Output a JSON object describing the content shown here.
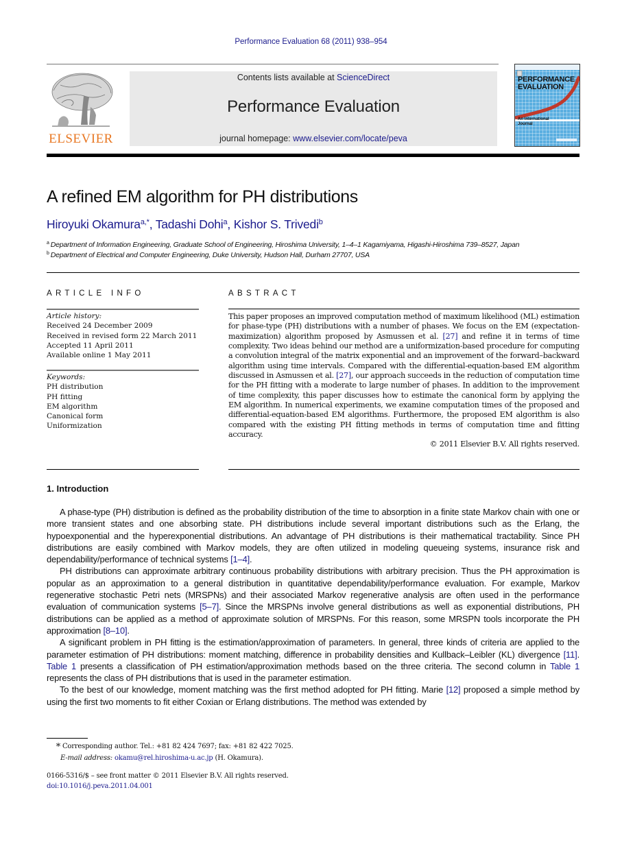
{
  "running_head": "Performance Evaluation 68 (2011) 938–954",
  "masthead": {
    "contents_prefix": "Contents lists available at ",
    "contents_link": "ScienceDirect",
    "journal_title": "Performance Evaluation",
    "homepage_prefix": "journal homepage: ",
    "homepage_link": "www.elsevier.com/locate/peva",
    "publisher_logo_text": "ELSEVIER",
    "cover_title_line1": "PERFORMANCE",
    "cover_title_line2": "EVALUATION",
    "cover_subtitle_line1": "An International",
    "cover_subtitle_line2": "Journal"
  },
  "article": {
    "title": "A refined EM algorithm for PH distributions",
    "authors": [
      {
        "name": "Hiroyuki Okamura",
        "marks": "a,*",
        "sep": ", "
      },
      {
        "name": "Tadashi Dohi",
        "marks": "a",
        "sep": ", "
      },
      {
        "name": "Kishor S. Trivedi",
        "marks": "b",
        "sep": ""
      }
    ],
    "affiliations": [
      {
        "mark": "a",
        "text": "Department of Information Engineering, Graduate School of Engineering, Hiroshima University, 1–4–1 Kagamiyama, Higashi-Hiroshima 739–8527, Japan"
      },
      {
        "mark": "b",
        "text": "Department of Electrical and Computer Engineering, Duke University, Hudson Hall, Durham 27707, USA"
      }
    ]
  },
  "article_info": {
    "label": "ARTICLE INFO",
    "history_heading": "Article history:",
    "history": [
      "Received 24 December 2009",
      "Received in revised form 22 March 2011",
      "Accepted 11 April 2011",
      "Available online 1 May 2011"
    ],
    "keywords_heading": "Keywords:",
    "keywords": [
      "PH distribution",
      "PH fitting",
      "EM algorithm",
      "Canonical form",
      "Uniformization"
    ]
  },
  "abstract": {
    "label": "ABSTRACT",
    "segments": [
      {
        "text": "This paper proposes an improved computation method of maximum likelihood (ML) estimation for phase-type (PH) distributions with a number of phases. We focus on the EM (expectation-maximization) algorithm proposed by Asmussen et al. ",
        "link": false
      },
      {
        "text": "[27]",
        "link": true
      },
      {
        "text": " and refine it in terms of time complexity. Two ideas behind our method are a uniformization-based procedure for computing a convolution integral of the matrix exponential and an improvement of the forward–backward algorithm using time intervals. Compared with the differential-equation-based EM algorithm discussed in Asmussen et al. ",
        "link": false
      },
      {
        "text": "[27]",
        "link": true
      },
      {
        "text": ", our approach succeeds in the reduction of computation time for the PH fitting with a moderate to large number of phases. In addition to the improvement of time complexity, this paper discusses how to estimate the canonical form by applying the EM algorithm. In numerical experiments, we examine computation times of the proposed and differential-equation-based EM algorithms. Furthermore, the proposed EM algorithm is also compared with the existing PH fitting methods in terms of computation time and fitting accuracy.",
        "link": false
      }
    ],
    "copyright": "© 2011 Elsevier B.V. All rights reserved."
  },
  "introduction": {
    "heading": "1.  Introduction",
    "paragraphs": [
      [
        {
          "text": "A phase-type (PH) distribution is defined as the probability distribution of the time to absorption in a finite state Markov chain with one or more transient states and one absorbing state. PH distributions include several important distributions such as the Erlang, the hypoexponential and the hyperexponential distributions. An advantage of PH distributions is their mathematical tractability. Since PH distributions are easily combined with Markov models, they are often utilized in modeling queueing systems, insurance risk and dependability/performance of technical systems ",
          "link": false
        },
        {
          "text": "[1–4]",
          "link": true
        },
        {
          "text": ".",
          "link": false
        }
      ],
      [
        {
          "text": "PH distributions can approximate arbitrary continuous probability distributions with arbitrary precision. Thus the PH approximation is popular as an approximation to a general distribution in quantitative dependability/performance evaluation. For example, Markov regenerative stochastic Petri nets (MRSPNs) and their associated Markov regenerative analysis are often used in the performance evaluation of communication systems ",
          "link": false
        },
        {
          "text": "[5–7]",
          "link": true
        },
        {
          "text": ". Since the MRSPNs involve general distributions as well as exponential distributions, PH distributions can be applied as a method of approximate solution of MRSPNs. For this reason, some MRSPN tools incorporate the PH approximation ",
          "link": false
        },
        {
          "text": "[8–10]",
          "link": true
        },
        {
          "text": ".",
          "link": false
        }
      ],
      [
        {
          "text": "A significant problem in PH fitting is the estimation/approximation of parameters. In general, three kinds of criteria are applied to the parameter estimation of PH distributions: moment matching, difference in probability densities and Kullback–Leibler (KL) divergence ",
          "link": false
        },
        {
          "text": "[11]",
          "link": true
        },
        {
          "text": ". ",
          "link": false
        },
        {
          "text": "Table 1",
          "link": true
        },
        {
          "text": " presents a classification of PH estimation/approximation methods based on the three criteria. The second column in ",
          "link": false
        },
        {
          "text": "Table 1",
          "link": true
        },
        {
          "text": " represents the class of PH distributions that is used in the parameter estimation.",
          "link": false
        }
      ],
      [
        {
          "text": "To the best of our knowledge, moment matching was the first method adopted for PH fitting. Marie ",
          "link": false
        },
        {
          "text": "[12]",
          "link": true
        },
        {
          "text": " proposed a simple method by using the first two moments to fit either Coxian or Erlang distributions. The method was extended by",
          "link": false
        }
      ]
    ]
  },
  "footnotes": {
    "star": "*",
    "corresponding": "Corresponding author. Tel.: +81 82 424 7697; fax: +81 82 422 7025.",
    "email_label": "E-mail address:",
    "email": "okamu@rel.hiroshima-u.ac.jp",
    "email_owner": " (H. Okamura).",
    "front_matter": "0166-5316/$ – see front matter © 2011 Elsevier B.V. All rights reserved.",
    "doi": "doi:10.1016/j.peva.2011.04.001"
  }
}
